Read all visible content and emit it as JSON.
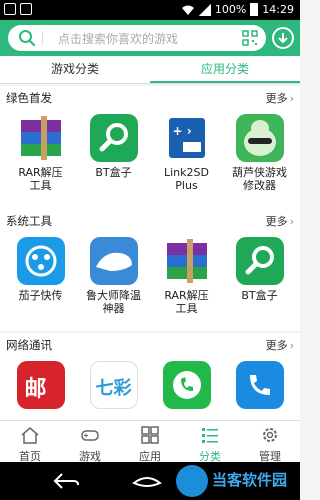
{
  "status_bar": {
    "battery": "100%",
    "time": "14:29"
  },
  "search": {
    "placeholder": "点击搜索你喜欢的游戏"
  },
  "tabs": [
    {
      "label": "游戏分类",
      "active": false
    },
    {
      "label": "应用分类",
      "active": true
    }
  ],
  "sections": [
    {
      "title": "绿色首发",
      "more": "更多",
      "apps": [
        {
          "name": "RAR解压\n工具",
          "icon": "rar-books-icon"
        },
        {
          "name": "BT盒子",
          "icon": "magnifier-icon"
        },
        {
          "name": "Link2SD\nPlus",
          "icon": "link2sd-icon"
        },
        {
          "name": "葫芦侠游戏\n修改器",
          "icon": "gourd-character-icon"
        }
      ]
    },
    {
      "title": "系统工具",
      "more": "更多",
      "apps": [
        {
          "name": "茄子快传",
          "icon": "share-icon"
        },
        {
          "name": "鲁大师降温\n神器",
          "icon": "polar-bear-icon"
        },
        {
          "name": "RAR解压\n工具",
          "icon": "rar-books-icon"
        },
        {
          "name": "BT盒子",
          "icon": "magnifier-icon"
        }
      ]
    },
    {
      "title": "网络通讯",
      "more": "更多",
      "apps": [
        {
          "name": "",
          "icon": "mail-logo-icon"
        },
        {
          "name": "",
          "icon": "colorful-logo-icon"
        },
        {
          "name": "",
          "icon": "phone-chat-icon"
        },
        {
          "name": "",
          "icon": "phone-call-icon"
        }
      ]
    }
  ],
  "bottom_nav": [
    {
      "label": "首页",
      "icon": "home-icon"
    },
    {
      "label": "游戏",
      "icon": "gamepad-icon"
    },
    {
      "label": "应用",
      "icon": "apps-grid-icon"
    },
    {
      "label": "分类",
      "icon": "list-icon",
      "active": true
    },
    {
      "label": "管理",
      "icon": "gear-icon"
    }
  ],
  "watermark": {
    "text": "当客软件园"
  },
  "colors": {
    "accent": "#2db87d"
  }
}
